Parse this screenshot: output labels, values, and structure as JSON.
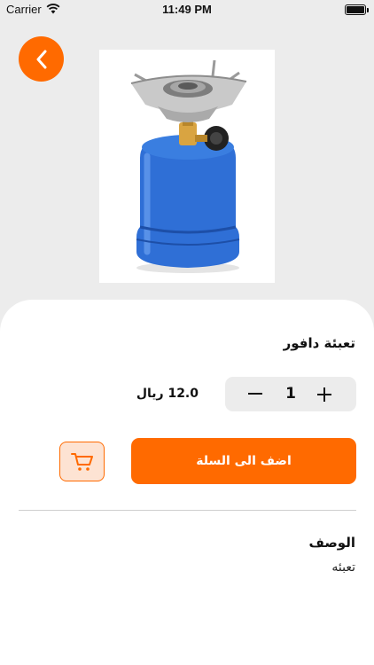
{
  "status_bar": {
    "carrier": "Carrier",
    "time": "11:49 PM"
  },
  "product": {
    "name": "تعبئة دافور",
    "price": "12.0 ريال",
    "quantity": "1",
    "image_icon": "camping-gas-stove-icon"
  },
  "actions": {
    "add_to_cart_label": "اضف الى السلة",
    "cart_icon": "cart-icon",
    "back_icon": "chevron-left-icon"
  },
  "description": {
    "title": "الوصف",
    "text": "تعبئه"
  },
  "colors": {
    "accent": "#ff6a00",
    "accent_light": "#fde3d3",
    "background": "#ececec",
    "surface": "#ffffff"
  }
}
